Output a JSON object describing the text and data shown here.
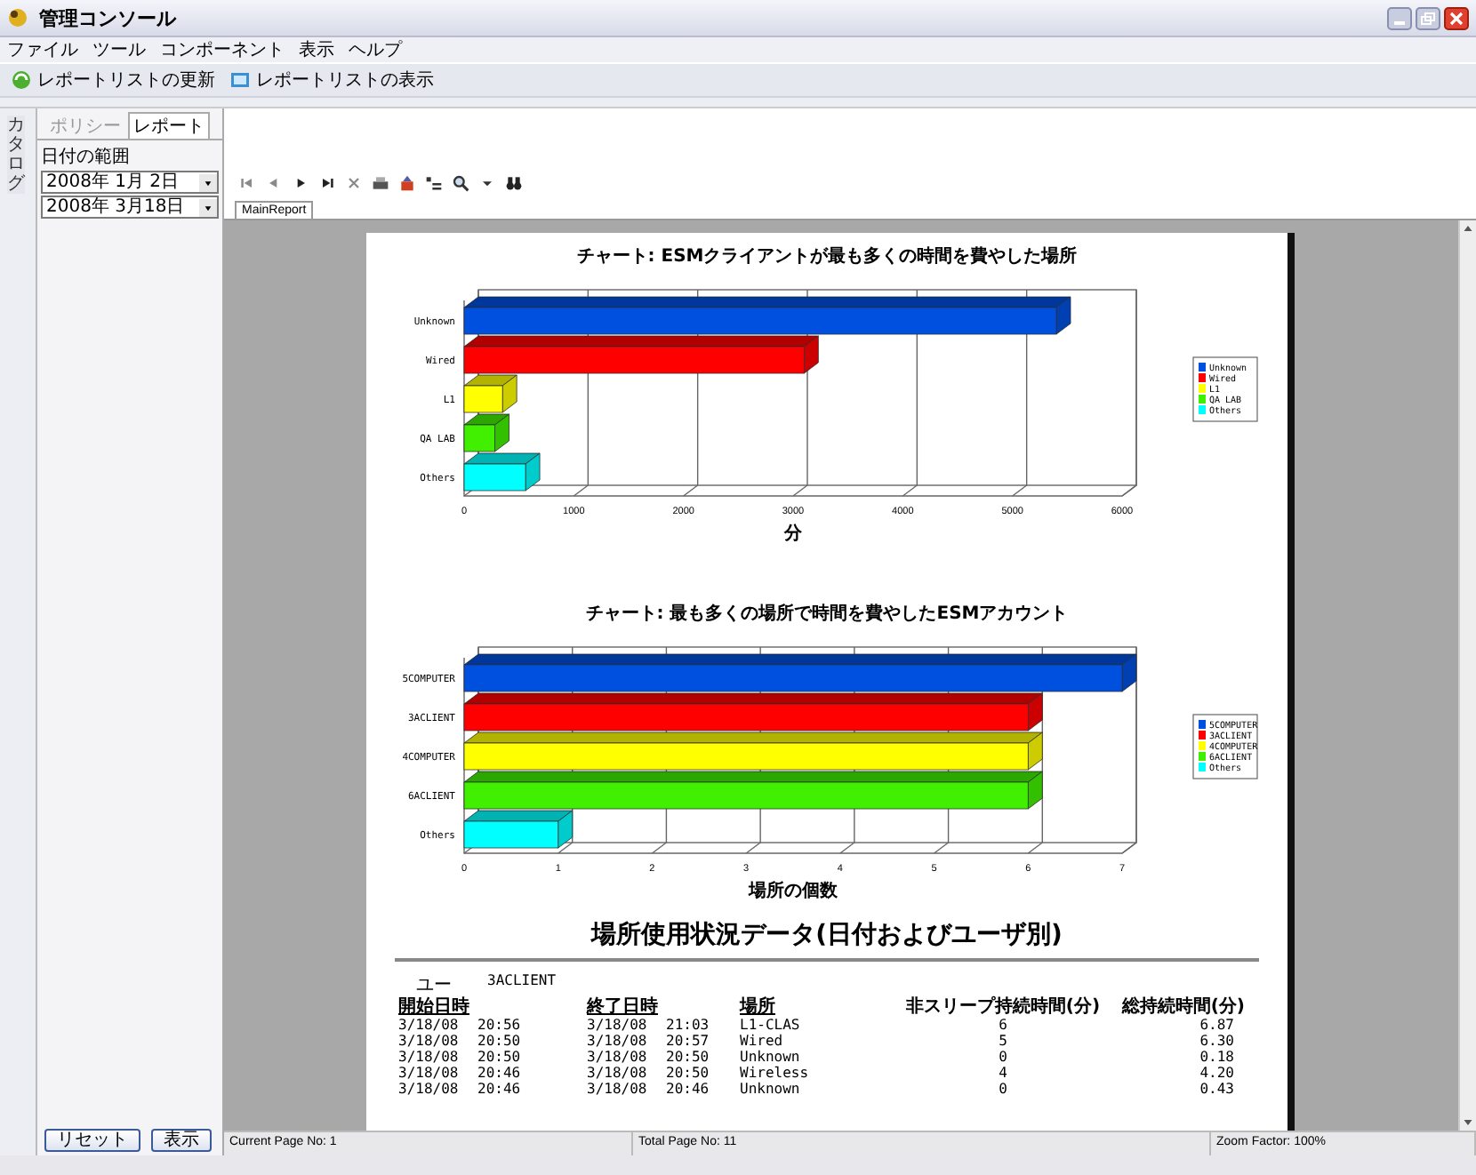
{
  "window": {
    "title": "管理コンソール"
  },
  "menu": [
    "ファイル",
    "ツール",
    "コンポーネント",
    "表示",
    "ヘルプ"
  ],
  "toolbar": [
    "レポートリストの更新",
    "レポートリストの表示"
  ],
  "side_tab": "カタログ",
  "panel_tabs": [
    {
      "label": "ポリシー",
      "selected": false
    },
    {
      "label": "レポート",
      "selected": true
    }
  ],
  "date_range": {
    "label": "日付の範囲",
    "from": "2008年 1月 2日",
    "to": "2008年 3月18日"
  },
  "panel_buttons": [
    "リセット",
    "表示"
  ],
  "viewer": {
    "tab": "MainReport",
    "status": [
      "Current Page No: 1",
      "Total Page No: 11",
      "Zoom Factor: 100%"
    ]
  },
  "report": {
    "charts": [
      {
        "legend": [
          {
            "label": "Unknown",
            "color": "#0050e0"
          },
          {
            "label": "Wired",
            "color": "#ff0000"
          },
          {
            "label": "L1",
            "color": "#ffff00"
          },
          {
            "label": "QA LAB",
            "color": "#40f000"
          },
          {
            "label": "Others",
            "color": "#00ffff"
          }
        ],
        "chart_data": {
          "type": "bar",
          "orientation": "horizontal",
          "title": "チャート: ESMクライアントが最も多くの時間を費やした場所",
          "xlabel": "分",
          "categories": [
            "Unknown",
            "Wired",
            "L1",
            "QA LAB",
            "Others"
          ],
          "values": [
            5400,
            3100,
            350,
            280,
            560
          ],
          "xlim": [
            0,
            6000
          ],
          "xticks": [
            0,
            1000,
            2000,
            3000,
            4000,
            5000,
            6000
          ]
        }
      },
      {
        "legend": [
          {
            "label": "5COMPUTER",
            "color": "#0050e0"
          },
          {
            "label": "3ACLIENT",
            "color": "#ff0000"
          },
          {
            "label": "4COMPUTER",
            "color": "#ffff00"
          },
          {
            "label": "6ACLIENT",
            "color": "#40f000"
          },
          {
            "label": "Others",
            "color": "#00ffff"
          }
        ],
        "chart_data": {
          "type": "bar",
          "orientation": "horizontal",
          "title": "チャート: 最も多くの場所で時間を費やしたESMアカウント",
          "xlabel": "場所の個数",
          "categories": [
            "5COMPUTER",
            "3ACLIENT",
            "4COMPUTER",
            "6ACLIENT",
            "Others"
          ],
          "values": [
            7,
            6,
            6,
            6,
            1
          ],
          "xlim": [
            0,
            7
          ],
          "xticks": [
            0,
            1,
            2,
            3,
            4,
            5,
            6,
            7
          ]
        }
      }
    ],
    "table": {
      "title": "場所使用状況データ(日付およびユーザ別)",
      "user_label": "ユー",
      "user": "3ACLIENT",
      "columns": [
        "開始日時",
        "終了日時",
        "場所",
        "非スリープ持続時間(分)",
        "総持続時間(分)"
      ],
      "rows": [
        [
          "3/18/08 20:56",
          "3/18/08 21:03",
          "L1-CLAS",
          "6",
          "6.87"
        ],
        [
          "3/18/08 20:50",
          "3/18/08 20:57",
          "Wired",
          "5",
          "6.30"
        ],
        [
          "3/18/08 20:50",
          "3/18/08 20:50",
          "Unknown",
          "0",
          "0.18"
        ],
        [
          "3/18/08 20:46",
          "3/18/08 20:50",
          "Wireless",
          "4",
          "4.20"
        ],
        [
          "3/18/08 20:46",
          "3/18/08 20:46",
          "Unknown",
          "0",
          "0.43"
        ]
      ]
    }
  }
}
